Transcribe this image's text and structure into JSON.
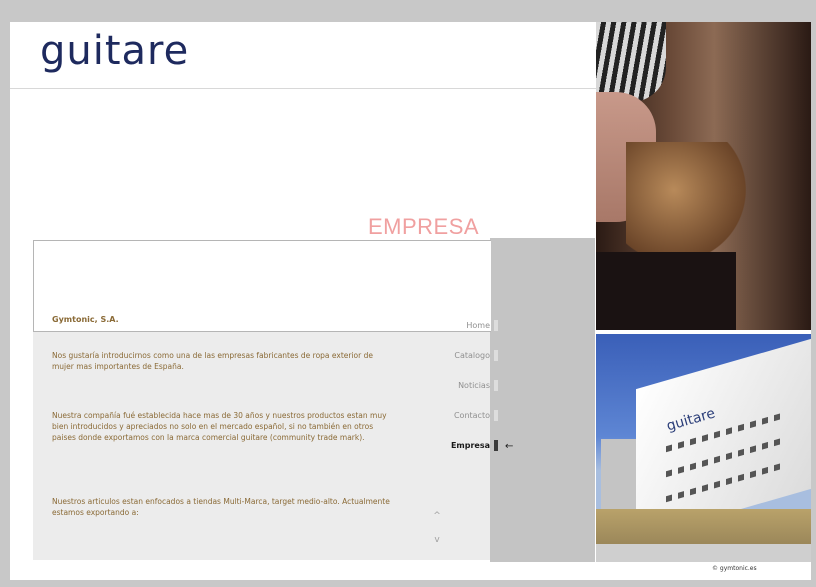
{
  "brand": {
    "logo_text": "guitare"
  },
  "section": {
    "title": "EMPRESA"
  },
  "company": {
    "name": "Gymtonic, S.A."
  },
  "content": {
    "paragraphs": [
      "Nos gustaría introducirnos como una de las empresas fabricantes de ropa exterior de mujer mas importantes de España.",
      "Nuestra compañía fué establecida hace mas de 30 años y nuestros productos estan muy bien introducidos y apreciados no solo en el mercado español, si no también en otros paises donde exportamos con la marca comercial guitare (community trade mark).",
      "Nuestros articulos estan enfocados a tiendas Multi-Marca, target medio-alto. Actualmente estamos exportando a:"
    ]
  },
  "nav": {
    "items": [
      {
        "label": "Home",
        "active": false
      },
      {
        "label": "Catalogo",
        "active": false
      },
      {
        "label": "Noticias",
        "active": false
      },
      {
        "label": "Contacto",
        "active": false
      },
      {
        "label": "Empresa",
        "active": true
      }
    ],
    "active_arrow": "←"
  },
  "scroll": {
    "up": "^",
    "down": "v"
  },
  "footer": {
    "copyright": "© gymtonic.es"
  },
  "photos": {
    "building_sign": "guitare"
  },
  "colors": {
    "logo": "#1e2a5e",
    "section_title": "#f0a0a0",
    "body_text": "#8a6a36"
  }
}
